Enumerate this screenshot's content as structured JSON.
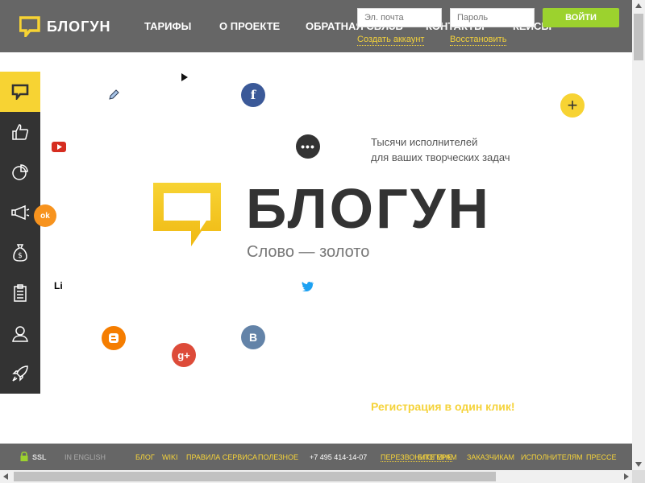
{
  "header": {
    "logo_text": "БЛОГУН",
    "nav": [
      "ТАРИФЫ",
      "О ПРОЕКТЕ",
      "ОБРАТНАЯ СВЯЗЬ",
      "КОНТАКТЫ",
      "КЕЙСЫ"
    ],
    "email_placeholder": "Эл. почта",
    "password_placeholder": "Пароль",
    "login_label": "ВОЙТИ",
    "create_account": "Создать аккаунт",
    "restore": "Восстановить"
  },
  "hero": {
    "tagline_line1": "Тысячи исполнителей",
    "tagline_line2": "для ваших творческих задач",
    "brand": "БЛОГУН",
    "slogan": "Слово — золото",
    "registration": "Регистрация в один клик!"
  },
  "social": {
    "livejournal": "Li",
    "vk": "B",
    "ok": "ok",
    "gplus": "g+"
  },
  "sidebar": {
    "icons": [
      "chat-bubble-icon",
      "thumbs-up-icon",
      "pie-chart-icon",
      "megaphone-icon",
      "money-bag-icon",
      "clipboard-icon",
      "user-icon",
      "rocket-icon"
    ]
  },
  "footer": {
    "ssl": "SSL",
    "english": "IN ENGLISH",
    "links": [
      "БЛОГ",
      "WIKI",
      "ПРАВИЛА СЕРВИСА",
      "ПОЛЕЗНОЕ"
    ],
    "phone": "+7 495 414-14-07",
    "callback": "ПЕРЕЗВОНИТЕ МНЕ",
    "right_links": [
      "БЛОГЕРАМ",
      "ЗАКАЗЧИКАМ",
      "ИСПОЛНИТЕЛЯМ",
      "ПРЕССЕ"
    ]
  },
  "colors": {
    "accent": "#f7d333",
    "dark": "#333333",
    "header": "#666666",
    "green": "#9cd22e"
  }
}
